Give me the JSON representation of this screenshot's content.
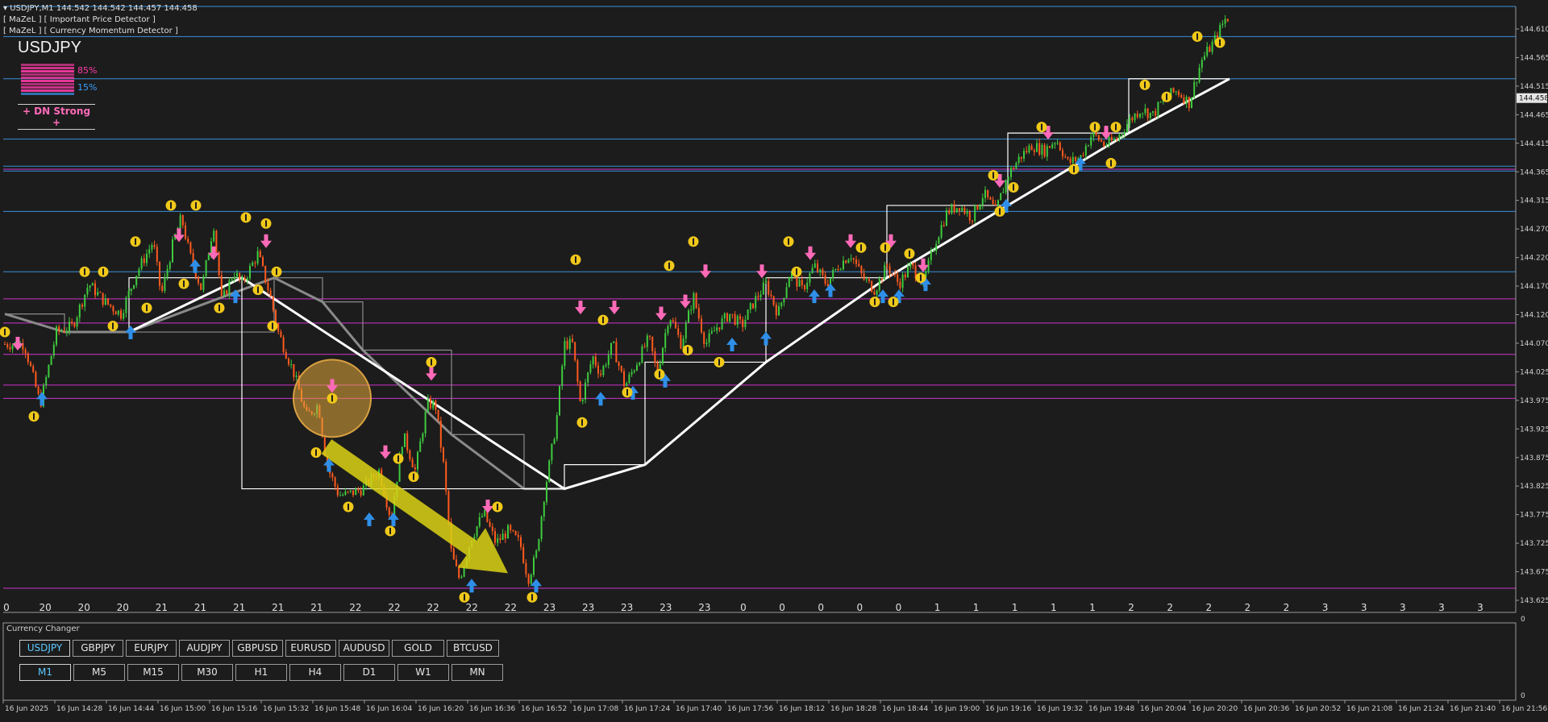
{
  "window": {
    "title_prefix": "USDJPY,M1",
    "ohlc": "144.542 144.542 144.457 144.458",
    "indicator_1": "[ MaZeL ] [ Important Price Detector ]",
    "indicator_2": "[ MaZeL ] [ Currency Momentum Detector ]"
  },
  "momentum": {
    "symbol": "USDJPY",
    "sell_pct": "85%",
    "buy_pct": "15%",
    "status": "+ DN Strong +",
    "colors": {
      "sell": "#ff3aa8",
      "buy": "#3aa0ff",
      "status": "#ff6ab8"
    }
  },
  "price_axis": {
    "labels": [
      "144.610",
      "144.565",
      "144.515",
      "144.465",
      "144.415",
      "144.365",
      "144.315",
      "144.270",
      "144.220",
      "144.170",
      "144.120",
      "144.070",
      "144.025",
      "143.975",
      "143.925",
      "143.875",
      "143.825",
      "143.775",
      "143.725",
      "143.675",
      "143.625"
    ],
    "current_price": "144.458"
  },
  "hour_scale": {
    "labels": [
      "0",
      "20",
      "20",
      "20",
      "21",
      "21",
      "21",
      "21",
      "21",
      "22",
      "22",
      "22",
      "22",
      "22",
      "23",
      "23",
      "23",
      "23",
      "23",
      "0",
      "0",
      "0",
      "0",
      "0",
      "1",
      "1",
      "1",
      "1",
      "1",
      "2",
      "2",
      "2",
      "2",
      "2",
      "3",
      "3",
      "3",
      "3",
      "3"
    ]
  },
  "time_axis": {
    "labels": [
      "16 Jun 2025",
      "16 Jun 14:28",
      "16 Jun 14:44",
      "16 Jun 15:00",
      "16 Jun 15:16",
      "16 Jun 15:32",
      "16 Jun 15:48",
      "16 Jun 16:04",
      "16 Jun 16:20",
      "16 Jun 16:36",
      "16 Jun 16:52",
      "16 Jun 17:08",
      "16 Jun 17:24",
      "16 Jun 17:40",
      "16 Jun 17:56",
      "16 Jun 18:12",
      "16 Jun 18:28",
      "16 Jun 18:44",
      "16 Jun 19:00",
      "16 Jun 19:16",
      "16 Jun 19:32",
      "16 Jun 19:48",
      "16 Jun 20:04",
      "16 Jun 20:20",
      "16 Jun 20:36",
      "16 Jun 20:52",
      "16 Jun 21:08",
      "16 Jun 21:24",
      "16 Jun 21:40",
      "16 Jun 21:56"
    ]
  },
  "currency_changer": {
    "title": "Currency Changer",
    "symbols": [
      "USDJPY",
      "GBPJPY",
      "EURJPY",
      "AUDJPY",
      "GBPUSD",
      "EURUSD",
      "AUDUSD",
      "GOLD",
      "BTCUSD"
    ],
    "active_symbol": "USDJPY",
    "timeframes": [
      "M1",
      "M5",
      "M15",
      "M30",
      "H1",
      "H4",
      "D1",
      "W1",
      "MN"
    ],
    "active_timeframe": "M1",
    "sub_axis_top": "0",
    "sub_axis_bottom": "0"
  },
  "chart_data": {
    "type": "candlestick",
    "symbol": "USDJPY",
    "timeframe": "M1",
    "ylim": [
      143.625,
      144.61
    ],
    "x_range": [
      "16 Jun 2025",
      "16 Jun 21:56"
    ],
    "close_path": [
      [
        0,
        144.05
      ],
      [
        30,
        144.05
      ],
      [
        50,
        143.95
      ],
      [
        70,
        144.07
      ],
      [
        90,
        144.08
      ],
      [
        110,
        144.15
      ],
      [
        130,
        144.12
      ],
      [
        150,
        144.1
      ],
      [
        170,
        144.17
      ],
      [
        190,
        144.22
      ],
      [
        200,
        144.13
      ],
      [
        215,
        144.22
      ],
      [
        225,
        144.26
      ],
      [
        235,
        144.2
      ],
      [
        250,
        144.14
      ],
      [
        265,
        144.25
      ],
      [
        275,
        144.12
      ],
      [
        290,
        144.17
      ],
      [
        300,
        144.15
      ],
      [
        320,
        144.2
      ],
      [
        335,
        144.13
      ],
      [
        345,
        144.07
      ],
      [
        365,
        144.0
      ],
      [
        380,
        143.93
      ],
      [
        395,
        143.95
      ],
      [
        405,
        143.85
      ],
      [
        420,
        143.8
      ],
      [
        430,
        143.8
      ],
      [
        450,
        143.81
      ],
      [
        470,
        143.84
      ],
      [
        485,
        143.76
      ],
      [
        500,
        143.9
      ],
      [
        515,
        143.84
      ],
      [
        530,
        143.95
      ],
      [
        540,
        143.95
      ],
      [
        550,
        143.85
      ],
      [
        560,
        143.7
      ],
      [
        570,
        143.66
      ],
      [
        585,
        143.73
      ],
      [
        600,
        143.77
      ],
      [
        615,
        143.72
      ],
      [
        630,
        143.74
      ],
      [
        645,
        143.72
      ],
      [
        655,
        143.66
      ],
      [
        665,
        143.7
      ],
      [
        675,
        143.8
      ],
      [
        690,
        143.92
      ],
      [
        700,
        144.05
      ],
      [
        710,
        144.05
      ],
      [
        720,
        143.95
      ],
      [
        735,
        144.03
      ],
      [
        745,
        144.0
      ],
      [
        760,
        144.05
      ],
      [
        775,
        143.98
      ],
      [
        790,
        144.02
      ],
      [
        805,
        144.06
      ],
      [
        815,
        144.0
      ],
      [
        830,
        144.1
      ],
      [
        845,
        144.05
      ],
      [
        860,
        144.13
      ],
      [
        875,
        144.05
      ],
      [
        890,
        144.08
      ],
      [
        905,
        144.1
      ],
      [
        920,
        144.08
      ],
      [
        935,
        144.12
      ],
      [
        950,
        144.15
      ],
      [
        965,
        144.1
      ],
      [
        980,
        144.17
      ],
      [
        995,
        144.14
      ],
      [
        1010,
        144.18
      ],
      [
        1025,
        144.15
      ],
      [
        1040,
        144.18
      ],
      [
        1055,
        144.2
      ],
      [
        1070,
        144.16
      ],
      [
        1085,
        144.14
      ],
      [
        1100,
        144.18
      ],
      [
        1115,
        144.15
      ],
      [
        1130,
        144.18
      ],
      [
        1145,
        144.15
      ],
      [
        1160,
        144.22
      ],
      [
        1175,
        144.27
      ],
      [
        1190,
        144.28
      ],
      [
        1205,
        144.26
      ],
      [
        1220,
        144.3
      ],
      [
        1235,
        144.27
      ],
      [
        1250,
        144.33
      ],
      [
        1265,
        144.36
      ],
      [
        1280,
        144.38
      ],
      [
        1295,
        144.37
      ],
      [
        1310,
        144.39
      ],
      [
        1325,
        144.35
      ],
      [
        1340,
        144.36
      ],
      [
        1355,
        144.4
      ],
      [
        1370,
        144.38
      ],
      [
        1385,
        144.39
      ],
      [
        1400,
        144.42
      ],
      [
        1415,
        144.44
      ],
      [
        1430,
        144.43
      ],
      [
        1445,
        144.46
      ],
      [
        1460,
        144.47
      ],
      [
        1475,
        144.45
      ],
      [
        1490,
        144.52
      ],
      [
        1505,
        144.55
      ],
      [
        1520,
        144.59
      ]
    ],
    "signals": {
      "pink_down": [
        [
          22,
          144.05
        ],
        [
          222,
          144.23
        ],
        [
          265,
          144.2
        ],
        [
          330,
          144.22
        ],
        [
          412,
          143.98
        ],
        [
          478,
          143.87
        ],
        [
          535,
          144.0
        ],
        [
          605,
          143.78
        ],
        [
          720,
          144.11
        ],
        [
          762,
          144.11
        ],
        [
          820,
          144.1
        ],
        [
          850,
          144.12
        ],
        [
          875,
          144.17
        ],
        [
          945,
          144.17
        ],
        [
          1005,
          144.2
        ],
        [
          1055,
          144.22
        ],
        [
          1105,
          144.22
        ],
        [
          1145,
          144.18
        ],
        [
          1240,
          144.32
        ],
        [
          1300,
          144.4
        ],
        [
          1372,
          144.4
        ]
      ],
      "blue_up": [
        [
          52,
          143.96
        ],
        [
          162,
          144.07
        ],
        [
          242,
          144.18
        ],
        [
          292,
          144.13
        ],
        [
          408,
          143.85
        ],
        [
          458,
          143.76
        ],
        [
          488,
          143.76
        ],
        [
          585,
          143.65
        ],
        [
          665,
          143.65
        ],
        [
          745,
          143.96
        ],
        [
          785,
          143.97
        ],
        [
          825,
          143.99
        ],
        [
          908,
          144.05
        ],
        [
          950,
          144.06
        ],
        [
          1010,
          144.13
        ],
        [
          1030,
          144.14
        ],
        [
          1095,
          144.13
        ],
        [
          1115,
          144.13
        ],
        [
          1148,
          144.15
        ],
        [
          1248,
          144.28
        ],
        [
          1340,
          144.35
        ]
      ],
      "yellow_markers": [
        [
          6,
          144.07
        ],
        [
          42,
          143.93
        ],
        [
          105,
          144.17
        ],
        [
          128,
          144.17
        ],
        [
          140,
          144.08
        ],
        [
          168,
          144.22
        ],
        [
          182,
          144.11
        ],
        [
          212,
          144.28
        ],
        [
          228,
          144.15
        ],
        [
          243,
          144.28
        ],
        [
          272,
          144.11
        ],
        [
          305,
          144.26
        ],
        [
          320,
          144.14
        ],
        [
          330,
          144.25
        ],
        [
          338,
          144.08
        ],
        [
          343,
          144.17
        ],
        [
          392,
          143.87
        ],
        [
          412,
          143.96
        ],
        [
          432,
          143.78
        ],
        [
          484,
          143.74
        ],
        [
          494,
          143.86
        ],
        [
          513,
          143.83
        ],
        [
          535,
          144.02
        ],
        [
          576,
          143.63
        ],
        [
          617,
          143.78
        ],
        [
          660,
          143.63
        ],
        [
          714,
          144.19
        ],
        [
          722,
          143.92
        ],
        [
          748,
          144.09
        ],
        [
          778,
          143.97
        ],
        [
          818,
          144.0
        ],
        [
          830,
          144.18
        ],
        [
          853,
          144.04
        ],
        [
          860,
          144.22
        ],
        [
          892,
          144.02
        ],
        [
          978,
          144.22
        ],
        [
          988,
          144.17
        ],
        [
          1068,
          144.21
        ],
        [
          1085,
          144.12
        ],
        [
          1098,
          144.21
        ],
        [
          1108,
          144.12
        ],
        [
          1128,
          144.2
        ],
        [
          1142,
          144.16
        ],
        [
          1232,
          144.33
        ],
        [
          1240,
          144.27
        ],
        [
          1257,
          144.31
        ],
        [
          1292,
          144.41
        ],
        [
          1332,
          144.34
        ],
        [
          1358,
          144.41
        ],
        [
          1378,
          144.35
        ],
        [
          1384,
          144.41
        ],
        [
          1420,
          144.48
        ],
        [
          1447,
          144.46
        ],
        [
          1485,
          144.56
        ],
        [
          1513,
          144.55
        ]
      ]
    },
    "trend_line_gray": [
      [
        6,
        144.1
      ],
      [
        80,
        144.07
      ],
      [
        160,
        144.07
      ],
      [
        340,
        144.16
      ],
      [
        400,
        144.12
      ],
      [
        450,
        144.04
      ],
      [
        560,
        143.9
      ],
      [
        650,
        143.81
      ],
      [
        700,
        143.81
      ]
    ],
    "trend_line_white": [
      [
        160,
        144.07
      ],
      [
        300,
        144.16
      ],
      [
        700,
        143.81
      ],
      [
        800,
        143.85
      ],
      [
        950,
        144.02
      ],
      [
        1100,
        144.16
      ],
      [
        1250,
        144.28
      ],
      [
        1400,
        144.4
      ],
      [
        1525,
        144.49
      ]
    ],
    "horizontal_levels": [
      {
        "price": 144.61,
        "color": "#3a8fd8"
      },
      {
        "price": 144.56,
        "color": "#3a8fd8"
      },
      {
        "price": 144.49,
        "color": "#3a8fd8"
      },
      {
        "price": 144.39,
        "color": "#3a8fd8"
      },
      {
        "price": 144.345,
        "color": "#3a8fd8"
      },
      {
        "price": 144.337,
        "color": "#3a8fd8"
      },
      {
        "price": 144.27,
        "color": "#3a8fd8"
      },
      {
        "price": 144.17,
        "color": "#3a8fd8"
      },
      {
        "price": 144.125,
        "color": "#cc33cc"
      },
      {
        "price": 144.085,
        "color": "#cc33cc"
      },
      {
        "price": 144.033,
        "color": "#cc33cc"
      },
      {
        "price": 143.982,
        "color": "#cc33cc"
      },
      {
        "price": 143.96,
        "color": "#cc33cc"
      },
      {
        "price": 144.34,
        "color": "#cc33cc"
      },
      {
        "price": 143.645,
        "color": "#cc33cc"
      }
    ],
    "highlight_circle": {
      "x": 412,
      "price": 143.96
    },
    "big_arrow": {
      "from": [
        405,
        143.88
      ],
      "to": [
        630,
        143.67
      ]
    }
  }
}
